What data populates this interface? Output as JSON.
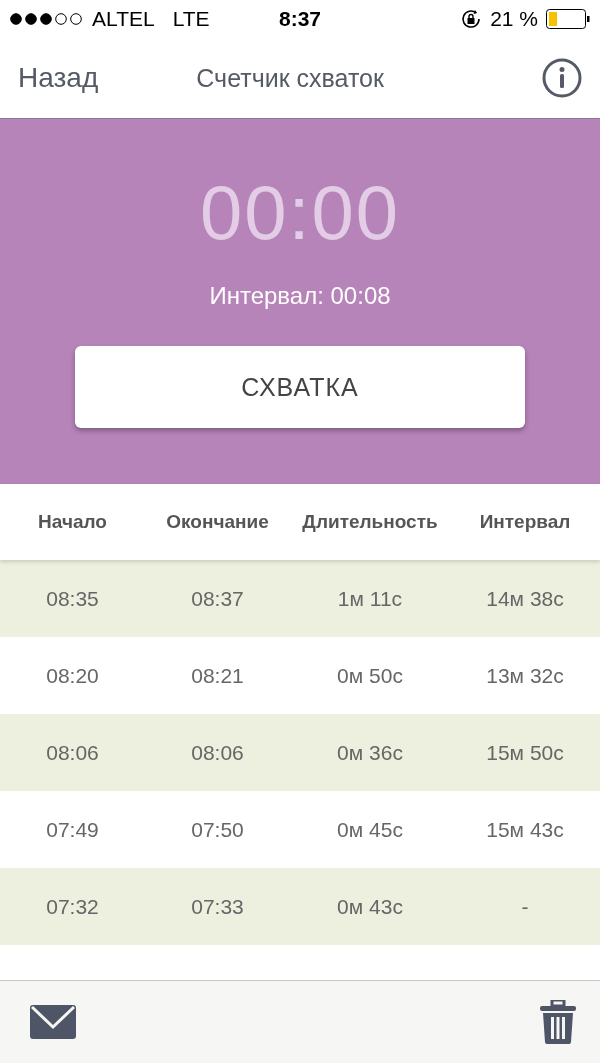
{
  "status_bar": {
    "carrier": "ALTEL",
    "network": "LTE",
    "time": "8:37",
    "battery": "21 %"
  },
  "nav": {
    "back": "Назад",
    "title": "Счетчик схваток"
  },
  "timer": {
    "display": "00:00",
    "interval": "Интервал: 00:08",
    "button": "СХВАТКА"
  },
  "table": {
    "columns": [
      "Начало",
      "Окончание",
      "Длительность",
      "Интервал"
    ],
    "rows": [
      [
        "08:35",
        "08:37",
        "1м 11с",
        "14м 38с"
      ],
      [
        "08:20",
        "08:21",
        "0м 50с",
        "13м 32с"
      ],
      [
        "08:06",
        "08:06",
        "0м 36с",
        "15м 50с"
      ],
      [
        "07:49",
        "07:50",
        "0м 45с",
        "15м 43с"
      ],
      [
        "07:32",
        "07:33",
        "0м 43с",
        "-"
      ]
    ]
  }
}
